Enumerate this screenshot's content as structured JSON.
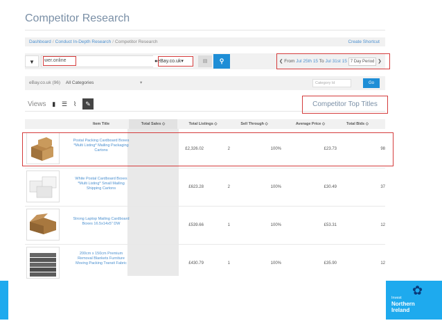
{
  "page": {
    "title": "Competitor Research"
  },
  "breadcrumb": {
    "items": [
      "Dashboard",
      "Conduct In-Depth Research"
    ],
    "current": "Competitor Research",
    "separator": "/"
  },
  "shortcut": {
    "label": "Create Shortcut"
  },
  "search": {
    "value": "wer.online",
    "site": "eBay.co.uk",
    "site_caret": "▾",
    "search_icon": "⚲",
    "filter_icon": "▼",
    "save_icon": "▤"
  },
  "daterange": {
    "prefix": "From",
    "from": "Jul 25th 15",
    "to_word": "To",
    "to": "Jul 31st 15",
    "period": "7 Day Period",
    "prev_icon": "❮",
    "next_icon": "❯"
  },
  "category": {
    "site": "eBay.co.uk (96)",
    "selected": "All Categories",
    "caret": "▾",
    "id_placeholder": "Category Id",
    "go_label": "Go"
  },
  "views": {
    "label": "Views",
    "icons": [
      "grid-icon",
      "list-icon",
      "chart-icon",
      "edit-icon"
    ]
  },
  "callout": {
    "label": "Competitor Top Titles"
  },
  "table": {
    "columns": [
      "Item Title",
      "Total Sales ◇",
      "Total Listings ◇",
      "Sell Through ◇",
      "Average Price ◇",
      "Total Bids ◇"
    ],
    "rows": [
      {
        "title": "Postal Packing Cardboard Boxes *Multi Listing* Mailing Packaging Cartons",
        "sales": "£2,326.02",
        "listings": "2",
        "sell_through": "100%",
        "avg_price": "£23.73",
        "bids": "98"
      },
      {
        "title": "White Postal Cardboard Boxes *Multi Listing* Small Mailing Shipping Cartons",
        "sales": "£623.28",
        "listings": "2",
        "sell_through": "100%",
        "avg_price": "£30.49",
        "bids": "37"
      },
      {
        "title": "Strong Laptop Mailing Cardboard Boxes 16.5x14x5\" DW",
        "sales": "£539.66",
        "listings": "1",
        "sell_through": "100%",
        "avg_price": "£53.31",
        "bids": "12"
      },
      {
        "title": "200cm x 150cm Premium Removal Blankets Furniture Moving Packing Transit Fabric",
        "sales": "£430.79",
        "listings": "1",
        "sell_through": "100%",
        "avg_price": "£35.90",
        "bids": "12"
      }
    ]
  },
  "footer": {
    "logo_small": "Invest",
    "logo_line1": "Northern",
    "logo_line2": "Ireland",
    "mark": "✿"
  },
  "colors": {
    "accent": "#1e8ed6",
    "brand_band": "#1eaaee",
    "highlight": "#d43a3a",
    "link": "#4a8fcf"
  }
}
